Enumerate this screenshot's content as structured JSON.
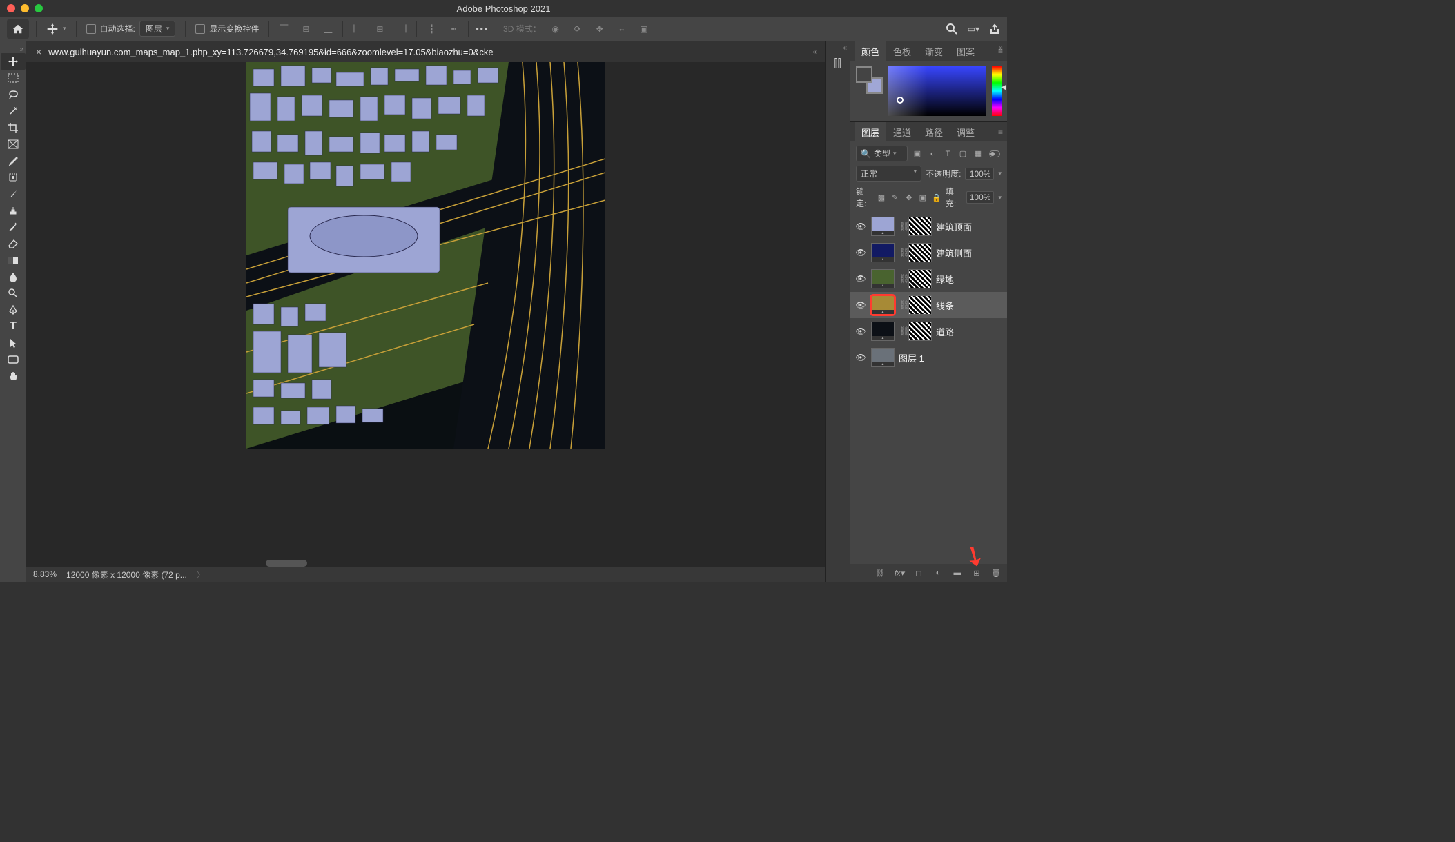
{
  "titlebar": {
    "title": "Adobe Photoshop 2021"
  },
  "optbar": {
    "auto_select_label": "自动选择:",
    "auto_select_target": "图层",
    "show_transform_label": "显示变换控件",
    "mode3d_label": "3D 模式："
  },
  "document": {
    "tab_name": "www.guihuayun.com_maps_map_1.php_xy=113.726679,34.769195&id=666&zoomlevel=17.05&biaozhu=0&cke"
  },
  "status": {
    "zoom": "8.83%",
    "info": "12000 像素 x 12000 像素 (72 p..."
  },
  "color_panel": {
    "tabs": [
      "颜色",
      "色板",
      "渐变",
      "图案"
    ],
    "active_tab": "颜色"
  },
  "layers_panel": {
    "tabs": [
      "图层",
      "通道",
      "路径",
      "调整"
    ],
    "active_tab": "图层",
    "filter_label": "类型",
    "blend_mode": "正常",
    "opacity_label": "不透明度:",
    "opacity_value": "100%",
    "lock_label": "锁定:",
    "fill_label": "填充:",
    "fill_value": "100%",
    "layers": [
      {
        "name": "建筑顶面",
        "color": "#9da5d4",
        "has_mask": true,
        "selected": false
      },
      {
        "name": "建筑侧面",
        "color": "#121a63",
        "has_mask": true,
        "selected": false
      },
      {
        "name": "绿地",
        "color": "#49632f",
        "has_mask": true,
        "selected": false
      },
      {
        "name": "线条",
        "color": "#a78a36",
        "has_mask": true,
        "selected": true
      },
      {
        "name": "道路",
        "color": "#0c1016",
        "has_mask": true,
        "selected": false
      },
      {
        "name": "图层 1",
        "color": "#6a7179",
        "has_mask": false,
        "selected": false
      }
    ]
  }
}
